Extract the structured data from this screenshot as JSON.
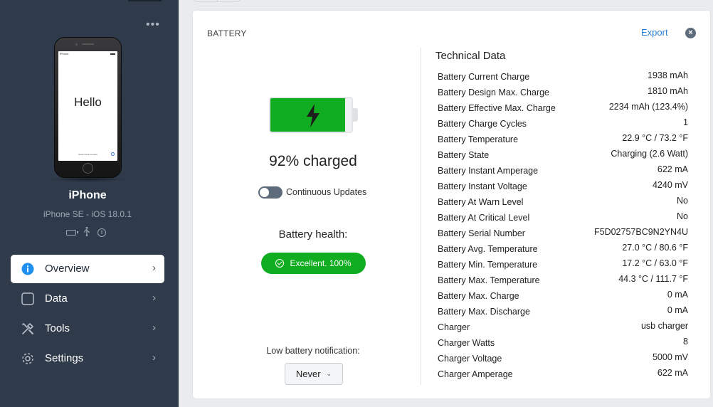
{
  "sidebar": {
    "device_name": "iPhone",
    "device_model": "iPhone SE - iOS 18.0.1",
    "phone_screen": {
      "status_left": "iPhone",
      "greeting": "Hello",
      "bottom_text": "Press home to open"
    },
    "nav": [
      {
        "label": "Overview",
        "icon": "info-icon",
        "active": true
      },
      {
        "label": "Data",
        "icon": "square-icon",
        "active": false
      },
      {
        "label": "Tools",
        "icon": "tools-icon",
        "active": false
      },
      {
        "label": "Settings",
        "icon": "gear-icon",
        "active": false
      }
    ]
  },
  "battery": {
    "section_title": "BATTERY",
    "export_label": "Export",
    "charge_level": 0.92,
    "charged_text": "92% charged",
    "continuous_updates_label": "Continuous Updates",
    "continuous_updates_on": false,
    "health_title": "Battery health:",
    "health_value": "Excellent. 100%",
    "low_battery_label": "Low battery notification:",
    "low_battery_value": "Never"
  },
  "technical": {
    "title": "Technical Data",
    "rows": [
      {
        "key": "Battery Current Charge",
        "value": "1938 mAh"
      },
      {
        "key": "Battery Design Max. Charge",
        "value": "1810 mAh"
      },
      {
        "key": "Battery Effective Max. Charge",
        "value": "2234 mAh (123.4%)"
      },
      {
        "key": "Battery Charge Cycles",
        "value": "1"
      },
      {
        "key": "Battery Temperature",
        "value": "22.9 °C / 73.2 °F"
      },
      {
        "key": "Battery State",
        "value": "Charging (2.6 Watt)"
      },
      {
        "key": "Battery Instant Amperage",
        "value": "622 mA"
      },
      {
        "key": "Battery Instant Voltage",
        "value": "4240 mV"
      },
      {
        "key": "Battery At Warn Level",
        "value": "No"
      },
      {
        "key": "Battery At Critical Level",
        "value": "No"
      },
      {
        "key": "Battery Serial Number",
        "value": "F5D02757BC9N2YN4U"
      },
      {
        "key": "Battery Avg. Temperature",
        "value": "27.0 °C / 80.6 °F"
      },
      {
        "key": "Battery Min. Temperature",
        "value": "17.2 °C / 63.0 °F"
      },
      {
        "key": "Battery Max. Temperature",
        "value": "44.3 °C / 111.7 °F"
      },
      {
        "key": "Battery Max. Charge",
        "value": "0 mA"
      },
      {
        "key": "Battery Max. Discharge",
        "value": "0 mA"
      },
      {
        "key": "Charger",
        "value": "usb charger"
      },
      {
        "key": "Charger Watts",
        "value": "8"
      },
      {
        "key": "Charger Voltage",
        "value": "5000 mV"
      },
      {
        "key": "Charger Amperage",
        "value": "622 mA"
      }
    ]
  },
  "colors": {
    "sidebar_bg": "#2f3b4a",
    "accent_green": "#11ad20",
    "link_blue": "#2b7fd6",
    "info_blue": "#1f8ff0"
  }
}
